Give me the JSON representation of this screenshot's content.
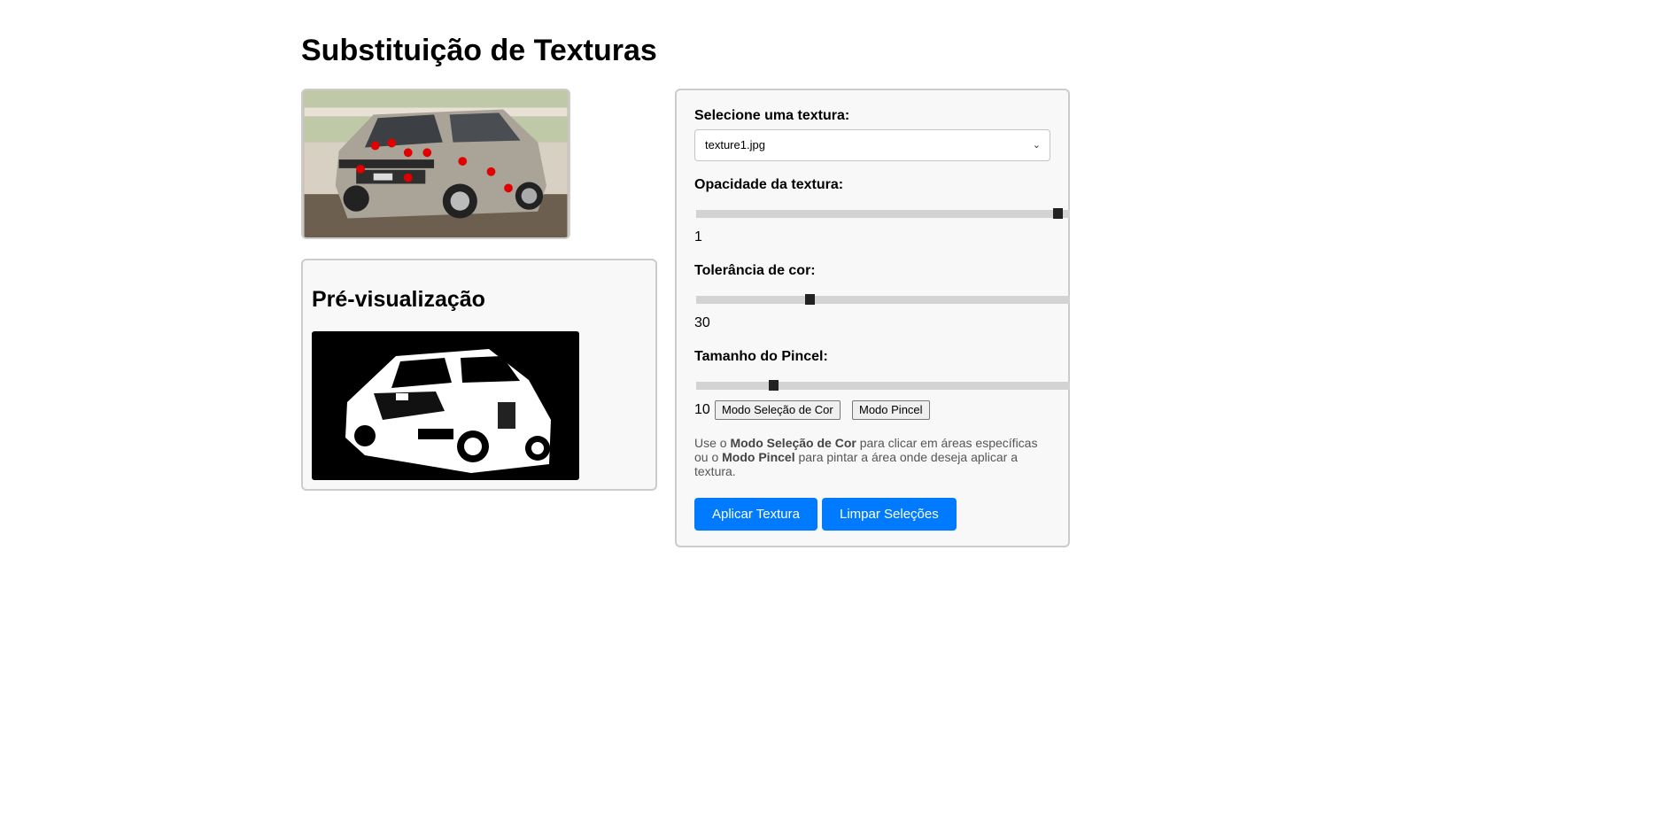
{
  "page": {
    "title": "Substituição de Texturas"
  },
  "source_image": {
    "alt": "car photo",
    "selection_marker_color": "#e00000"
  },
  "preview": {
    "title": "Pré-visualização"
  },
  "controls": {
    "texture": {
      "label": "Selecione uma textura:",
      "selected": "texture1.jpg"
    },
    "opacity": {
      "label": "Opacidade da textura:",
      "value": "1",
      "level": 0.98
    },
    "tolerance": {
      "label": "Tolerância de cor:",
      "value": "30",
      "level": 0.3
    },
    "brush": {
      "label": "Tamanho do Pincel:",
      "value": "10",
      "level": 0.2
    },
    "mode_color_label": "Modo Seleção de Cor",
    "mode_brush_label": "Modo Pincel",
    "help": {
      "part1": "Use o ",
      "bold1": "Modo Seleção de Cor",
      "part2": " para clicar em áreas específicas ou o ",
      "bold2": "Modo Pincel",
      "part3": " para pintar a área onde deseja aplicar a textura."
    },
    "apply_label": "Aplicar Textura",
    "clear_label": "Limpar Seleções"
  },
  "colors": {
    "accent": "#007bff",
    "panel_bg": "#f8f8f8",
    "border": "#cccccc"
  }
}
